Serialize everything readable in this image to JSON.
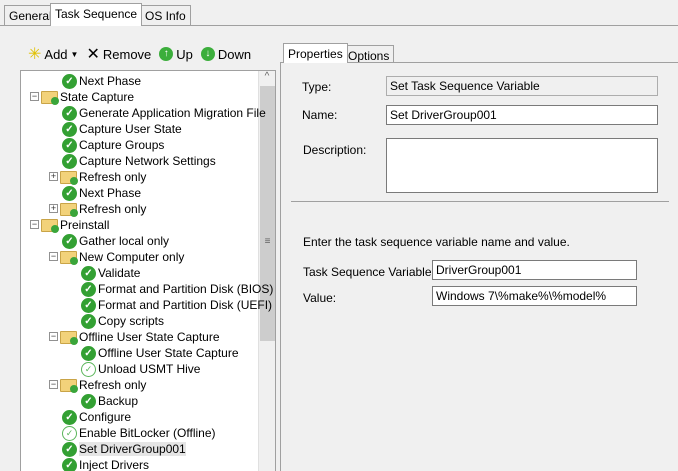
{
  "tabs": [
    "General",
    "Task Sequence",
    "OS Info"
  ],
  "active_tab": "Task Sequence",
  "toolbar": {
    "add": "Add",
    "remove": "Remove",
    "up": "Up",
    "down": "Down"
  },
  "tree": [
    {
      "label": "Next Phase",
      "level": 2,
      "icon": "check"
    },
    {
      "label": "State Capture",
      "level": 1,
      "icon": "folder",
      "expander": "-"
    },
    {
      "label": "Generate Application Migration File",
      "level": 2,
      "icon": "check"
    },
    {
      "label": "Capture User State",
      "level": 2,
      "icon": "check"
    },
    {
      "label": "Capture Groups",
      "level": 2,
      "icon": "check"
    },
    {
      "label": "Capture Network Settings",
      "level": 2,
      "icon": "check"
    },
    {
      "label": "Refresh only",
      "level": 2,
      "icon": "folder",
      "expander": "+"
    },
    {
      "label": "Next Phase",
      "level": 2,
      "icon": "check"
    },
    {
      "label": "Refresh only",
      "level": 2,
      "icon": "folder",
      "expander": "+"
    },
    {
      "label": "Preinstall",
      "level": 1,
      "icon": "folder",
      "expander": "-"
    },
    {
      "label": "Gather local only",
      "level": 2,
      "icon": "check"
    },
    {
      "label": "New Computer only",
      "level": 2,
      "icon": "folder",
      "expander": "-"
    },
    {
      "label": "Validate",
      "level": 3,
      "icon": "check"
    },
    {
      "label": "Format and Partition Disk (BIOS)",
      "level": 3,
      "icon": "check"
    },
    {
      "label": "Format and Partition Disk (UEFI)",
      "level": 3,
      "icon": "check"
    },
    {
      "label": "Copy scripts",
      "level": 3,
      "icon": "check"
    },
    {
      "label": "Offline User State Capture",
      "level": 2,
      "icon": "folder",
      "expander": "-"
    },
    {
      "label": "Offline User State Capture",
      "level": 3,
      "icon": "check"
    },
    {
      "label": "Unload USMT Hive",
      "level": 3,
      "icon": "disabled"
    },
    {
      "label": "Refresh only",
      "level": 2,
      "icon": "folder",
      "expander": "-"
    },
    {
      "label": "Backup",
      "level": 3,
      "icon": "check"
    },
    {
      "label": "Configure",
      "level": 2,
      "icon": "check"
    },
    {
      "label": "Enable BitLocker (Offline)",
      "level": 2,
      "icon": "disabled"
    },
    {
      "label": "Set DriverGroup001",
      "level": 2,
      "icon": "check",
      "selected": true
    },
    {
      "label": "Inject Drivers",
      "level": 2,
      "icon": "check"
    }
  ],
  "props_tabs": [
    "Properties",
    "Options"
  ],
  "props": {
    "type_label": "Type:",
    "type_value": "Set Task Sequence Variable",
    "name_label": "Name:",
    "name_value": "Set DriverGroup001",
    "desc_label": "Description:",
    "desc_value": "",
    "instructions": "Enter the task sequence variable name and value.",
    "var_label": "Task Sequence Variable:",
    "var_value": "DriverGroup001",
    "value_label": "Value:",
    "value_value": "Windows 7\\%make%\\%model%"
  }
}
